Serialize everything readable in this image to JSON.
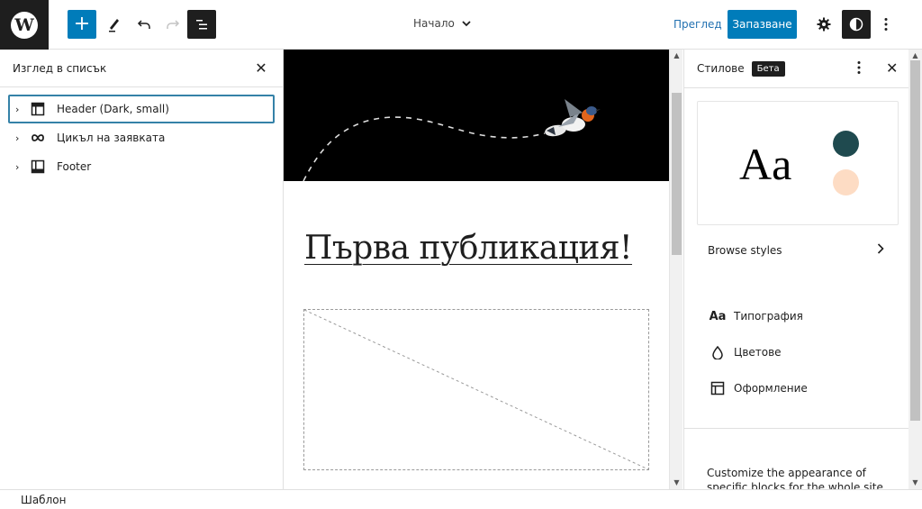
{
  "topbar": {
    "logo": "wordpress-logo",
    "add_block_label": "+",
    "document_title": "Начало",
    "preview_label": "Преглед",
    "save_label": "Запазване",
    "icons": {
      "add": "plus-icon",
      "edit": "pencil-icon",
      "undo": "undo-icon",
      "redo": "redo-icon",
      "list_view": "list-view-icon",
      "settings": "gear-icon",
      "styles": "half-circle-contrast-icon",
      "more": "vertical-ellipsis-icon"
    }
  },
  "list_view": {
    "title": "Изглед в списък",
    "close_label": "✕",
    "items": [
      {
        "label": "Header (Dark, small)",
        "icon": "template-part-header-icon",
        "selected": true
      },
      {
        "label": "Цикъл на заявката",
        "icon": "loop-icon",
        "selected": false
      },
      {
        "label": "Footer",
        "icon": "template-part-footer-icon",
        "selected": false
      }
    ]
  },
  "canvas": {
    "post_title": "Първа публикация!",
    "featured_image": "placeholder"
  },
  "styles_panel": {
    "title": "Стилове",
    "badge": "Бета",
    "preview_text": "Aa",
    "colors": [
      "#1f4a4f",
      "#fddcc4"
    ],
    "browse_label": "Browse styles",
    "nav": [
      {
        "label": "Типография",
        "icon": "typography-icon",
        "glyph": "Aa"
      },
      {
        "label": "Цветове",
        "icon": "color-drop-icon",
        "glyph": ""
      },
      {
        "label": "Оформление",
        "icon": "layout-icon",
        "glyph": ""
      }
    ],
    "blocks_description": "Customize the appearance of specific blocks for the whole site."
  },
  "footer": {
    "breadcrumb": "Шаблон"
  },
  "colors": {
    "primary": "#007cba",
    "dark": "#1e1e1e",
    "link": "#2271b1"
  }
}
